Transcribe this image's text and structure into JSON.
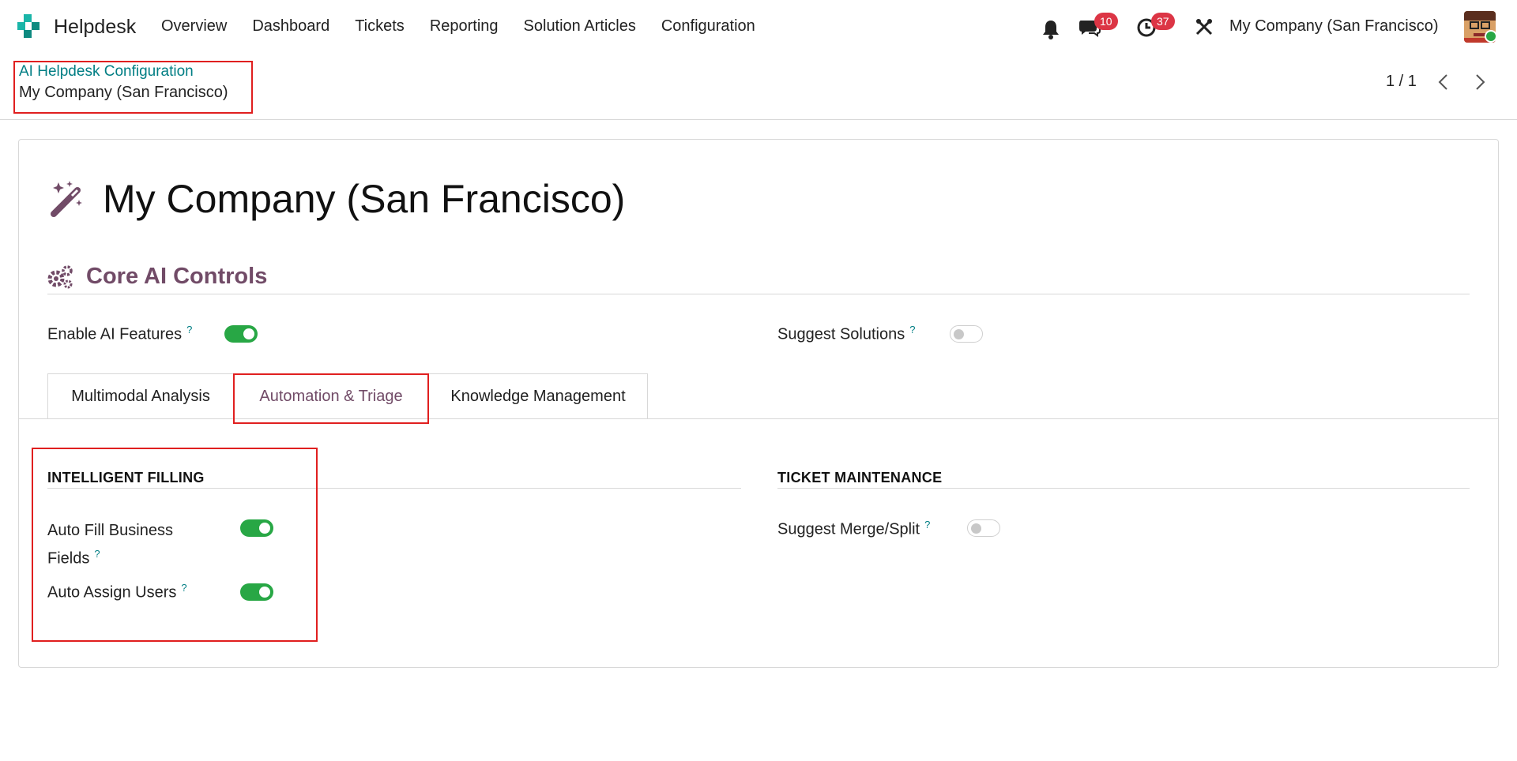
{
  "app": {
    "name": "Helpdesk",
    "menu": [
      "Overview",
      "Dashboard",
      "Tickets",
      "Reporting",
      "Solution Articles",
      "Configuration"
    ],
    "messages_count": "10",
    "activities_count": "37",
    "company": "My Company (San Francisco)"
  },
  "breadcrumb": {
    "parent": "AI Helpdesk Configuration",
    "current": "My Company (San Francisco)"
  },
  "pager": {
    "value": "1 / 1"
  },
  "record": {
    "title": "My Company (San Francisco)",
    "section_title": "Core AI Controls",
    "help_mark": "?",
    "enable_ai_label": "Enable AI Features",
    "enable_ai_on": true,
    "suggest_solutions_label": "Suggest Solutions",
    "suggest_solutions_on": false
  },
  "tabs": [
    {
      "label": "Multimodal Analysis",
      "active": false
    },
    {
      "label": "Automation & Triage",
      "active": true
    },
    {
      "label": "Knowledge Management",
      "active": false
    }
  ],
  "groups": {
    "intelligent_filling": {
      "title": "INTELLIGENT FILLING",
      "auto_fill_label_line1": "Auto Fill Business",
      "auto_fill_label_line2": "Fields",
      "auto_fill_on": true,
      "auto_assign_label": "Auto Assign Users",
      "auto_assign_on": true
    },
    "ticket_maintenance": {
      "title": "TICKET MAINTENANCE",
      "merge_split_label": "Suggest Merge/Split",
      "merge_split_on": false
    }
  },
  "colors": {
    "brand": "#714b67",
    "link": "#017e84",
    "toggle_on": "#28a745",
    "badge": "#dc3545",
    "highlight": "#e01f1f"
  }
}
